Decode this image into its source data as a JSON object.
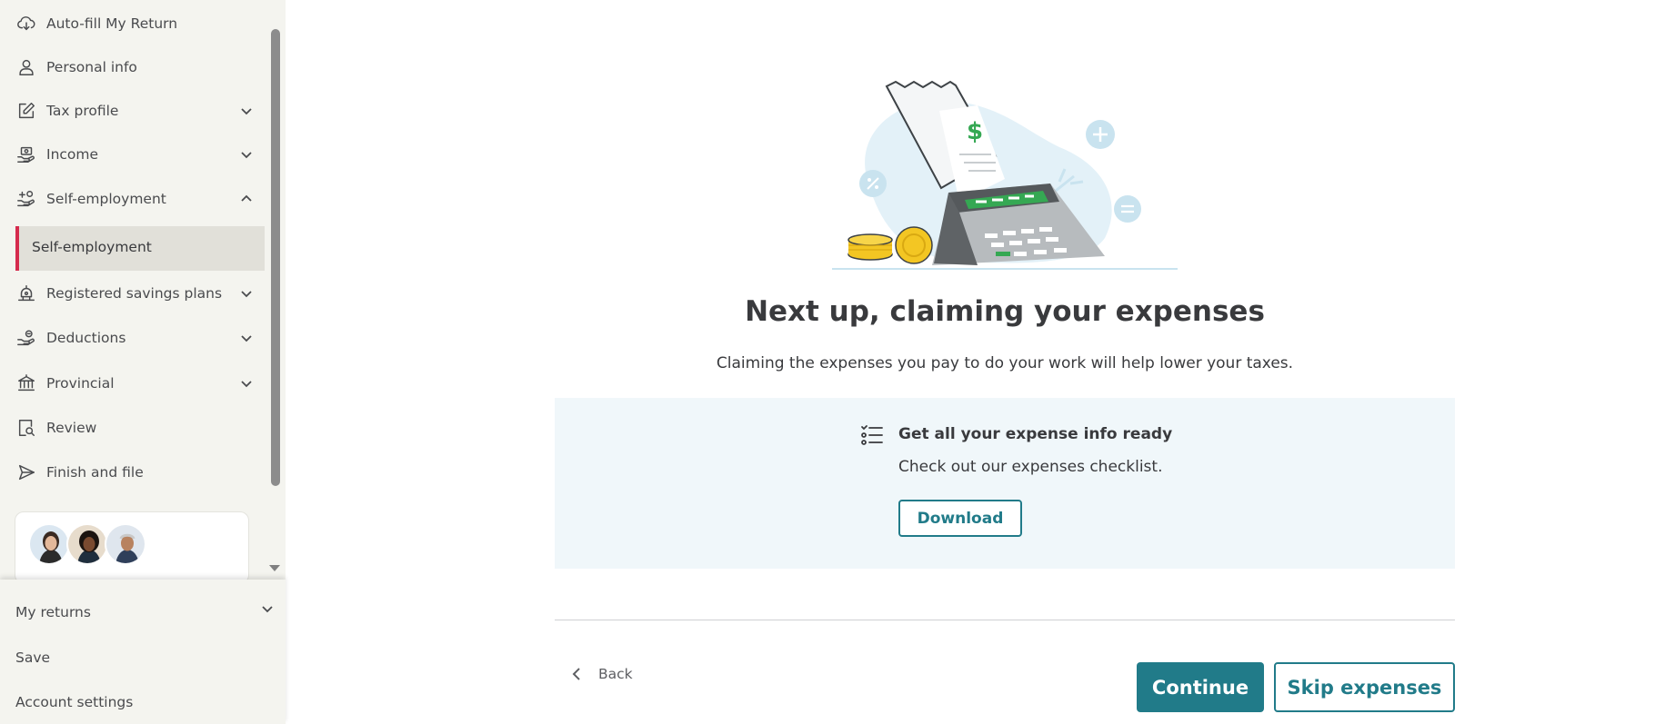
{
  "colors": {
    "accent": "#217b89",
    "active_marker": "#d52b4d",
    "sidebar_bg": "#f4f4ef",
    "info_bg": "#f0f7fa"
  },
  "sidebar": {
    "items": [
      {
        "label": "Auto-fill My Return",
        "icon": "cloud-download-icon"
      },
      {
        "label": "Personal info",
        "icon": "person-icon"
      },
      {
        "label": "Tax profile",
        "icon": "edit-icon",
        "chevron": "down"
      },
      {
        "label": "Income",
        "icon": "hand-money-icon",
        "chevron": "down"
      },
      {
        "label": "Self-employment",
        "icon": "self-employment-icon",
        "chevron": "up"
      },
      {
        "label": "Registered savings plans",
        "icon": "piggy-bank-icon",
        "chevron": "down"
      },
      {
        "label": "Deductions",
        "icon": "deductions-icon",
        "chevron": "down"
      },
      {
        "label": "Provincial",
        "icon": "bank-icon",
        "chevron": "down"
      },
      {
        "label": "Review",
        "icon": "review-icon"
      },
      {
        "label": "Finish and file",
        "icon": "send-icon"
      }
    ],
    "active_sub_item": "Self-employment"
  },
  "bottom_menu": {
    "my_returns": "My returns",
    "save": "Save",
    "account_settings": "Account settings"
  },
  "main": {
    "title": "Next up, claiming your expenses",
    "subtitle": "Claiming the expenses you pay to do your work will help lower your taxes.",
    "info_box": {
      "title": "Get all your expense info ready",
      "text": "Check out our expenses checklist.",
      "download_label": "Download"
    },
    "back_label": "Back",
    "continue_label": "Continue",
    "skip_label": "Skip expenses"
  }
}
